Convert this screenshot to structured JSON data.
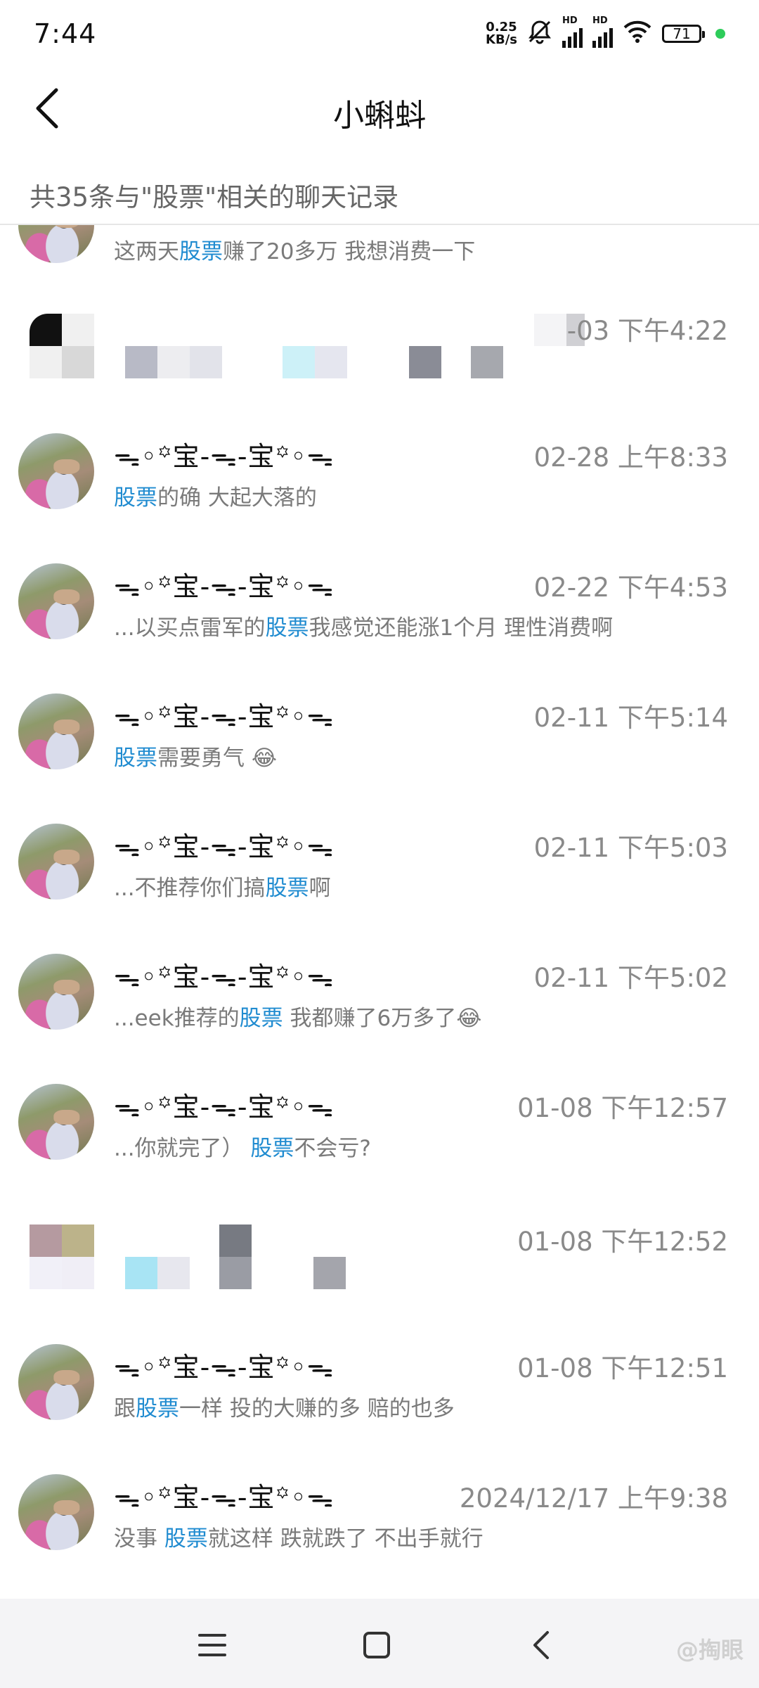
{
  "status_bar": {
    "time": "7:44",
    "speed_value": "0.25",
    "speed_unit": "KB/s",
    "hd_label": "HD",
    "battery": "71"
  },
  "nav": {
    "title": "小蝌蚪"
  },
  "summary": "共35条与\"股票\"相关的聊天记录",
  "results": [
    {
      "name": "",
      "time": "",
      "msg_prefix": "这两天",
      "keyword": "股票",
      "msg_suffix": "赚了20多万  我想消费一下"
    },
    {
      "name": "",
      "time": "-03 下午4:22",
      "msg_prefix": "",
      "keyword": "",
      "msg_suffix": ""
    },
    {
      "name": "ᯓ◦꙳宝-ᯓ-宝꙳◦ᯓ",
      "time": "02-28 上午8:33",
      "msg_prefix": "",
      "keyword": "股票",
      "msg_suffix": "的确   大起大落的"
    },
    {
      "name": "ᯓ◦꙳宝-ᯓ-宝꙳◦ᯓ",
      "time": "02-22 下午4:53",
      "msg_prefix": "...以买点雷军的",
      "keyword": "股票",
      "msg_suffix": "我感觉还能涨1个月   理性消费啊"
    },
    {
      "name": "ᯓ◦꙳宝-ᯓ-宝꙳◦ᯓ",
      "time": "02-11 下午5:14",
      "msg_prefix": "",
      "keyword": "股票",
      "msg_suffix": "需要勇气   😂"
    },
    {
      "name": "ᯓ◦꙳宝-ᯓ-宝꙳◦ᯓ",
      "time": "02-11 下午5:03",
      "msg_prefix": "...不推荐你们搞",
      "keyword": "股票",
      "msg_suffix": "啊"
    },
    {
      "name": "ᯓ◦꙳宝-ᯓ-宝꙳◦ᯓ",
      "time": "02-11 下午5:02",
      "msg_prefix": "...eek推荐的",
      "keyword": "股票",
      "msg_suffix": "  我都赚了6万多了😂"
    },
    {
      "name": "ᯓ◦꙳宝-ᯓ-宝꙳◦ᯓ",
      "time": "01-08 下午12:57",
      "msg_prefix": "...你就完了）  ",
      "keyword": "股票",
      "msg_suffix": "不会亏?"
    },
    {
      "name": "",
      "time": "01-08 下午12:52",
      "msg_prefix": "",
      "keyword": "",
      "msg_suffix": ""
    },
    {
      "name": "ᯓ◦꙳宝-ᯓ-宝꙳◦ᯓ",
      "time": "01-08 下午12:51",
      "msg_prefix": "跟",
      "keyword": "股票",
      "msg_suffix": "一样  投的大赚的多  赔的也多"
    },
    {
      "name": "ᯓ◦꙳宝-ᯓ-宝꙳◦ᯓ",
      "time": "2024/12/17 上午9:38",
      "msg_prefix": "没事 ",
      "keyword": "股票",
      "msg_suffix": "就这样 跌就跌了  不出手就行"
    }
  ],
  "watermark": "@掏眼",
  "colors": {
    "keyword": "#1f8bd0",
    "time": "#8a8a8a",
    "message": "#7a7a7a"
  }
}
